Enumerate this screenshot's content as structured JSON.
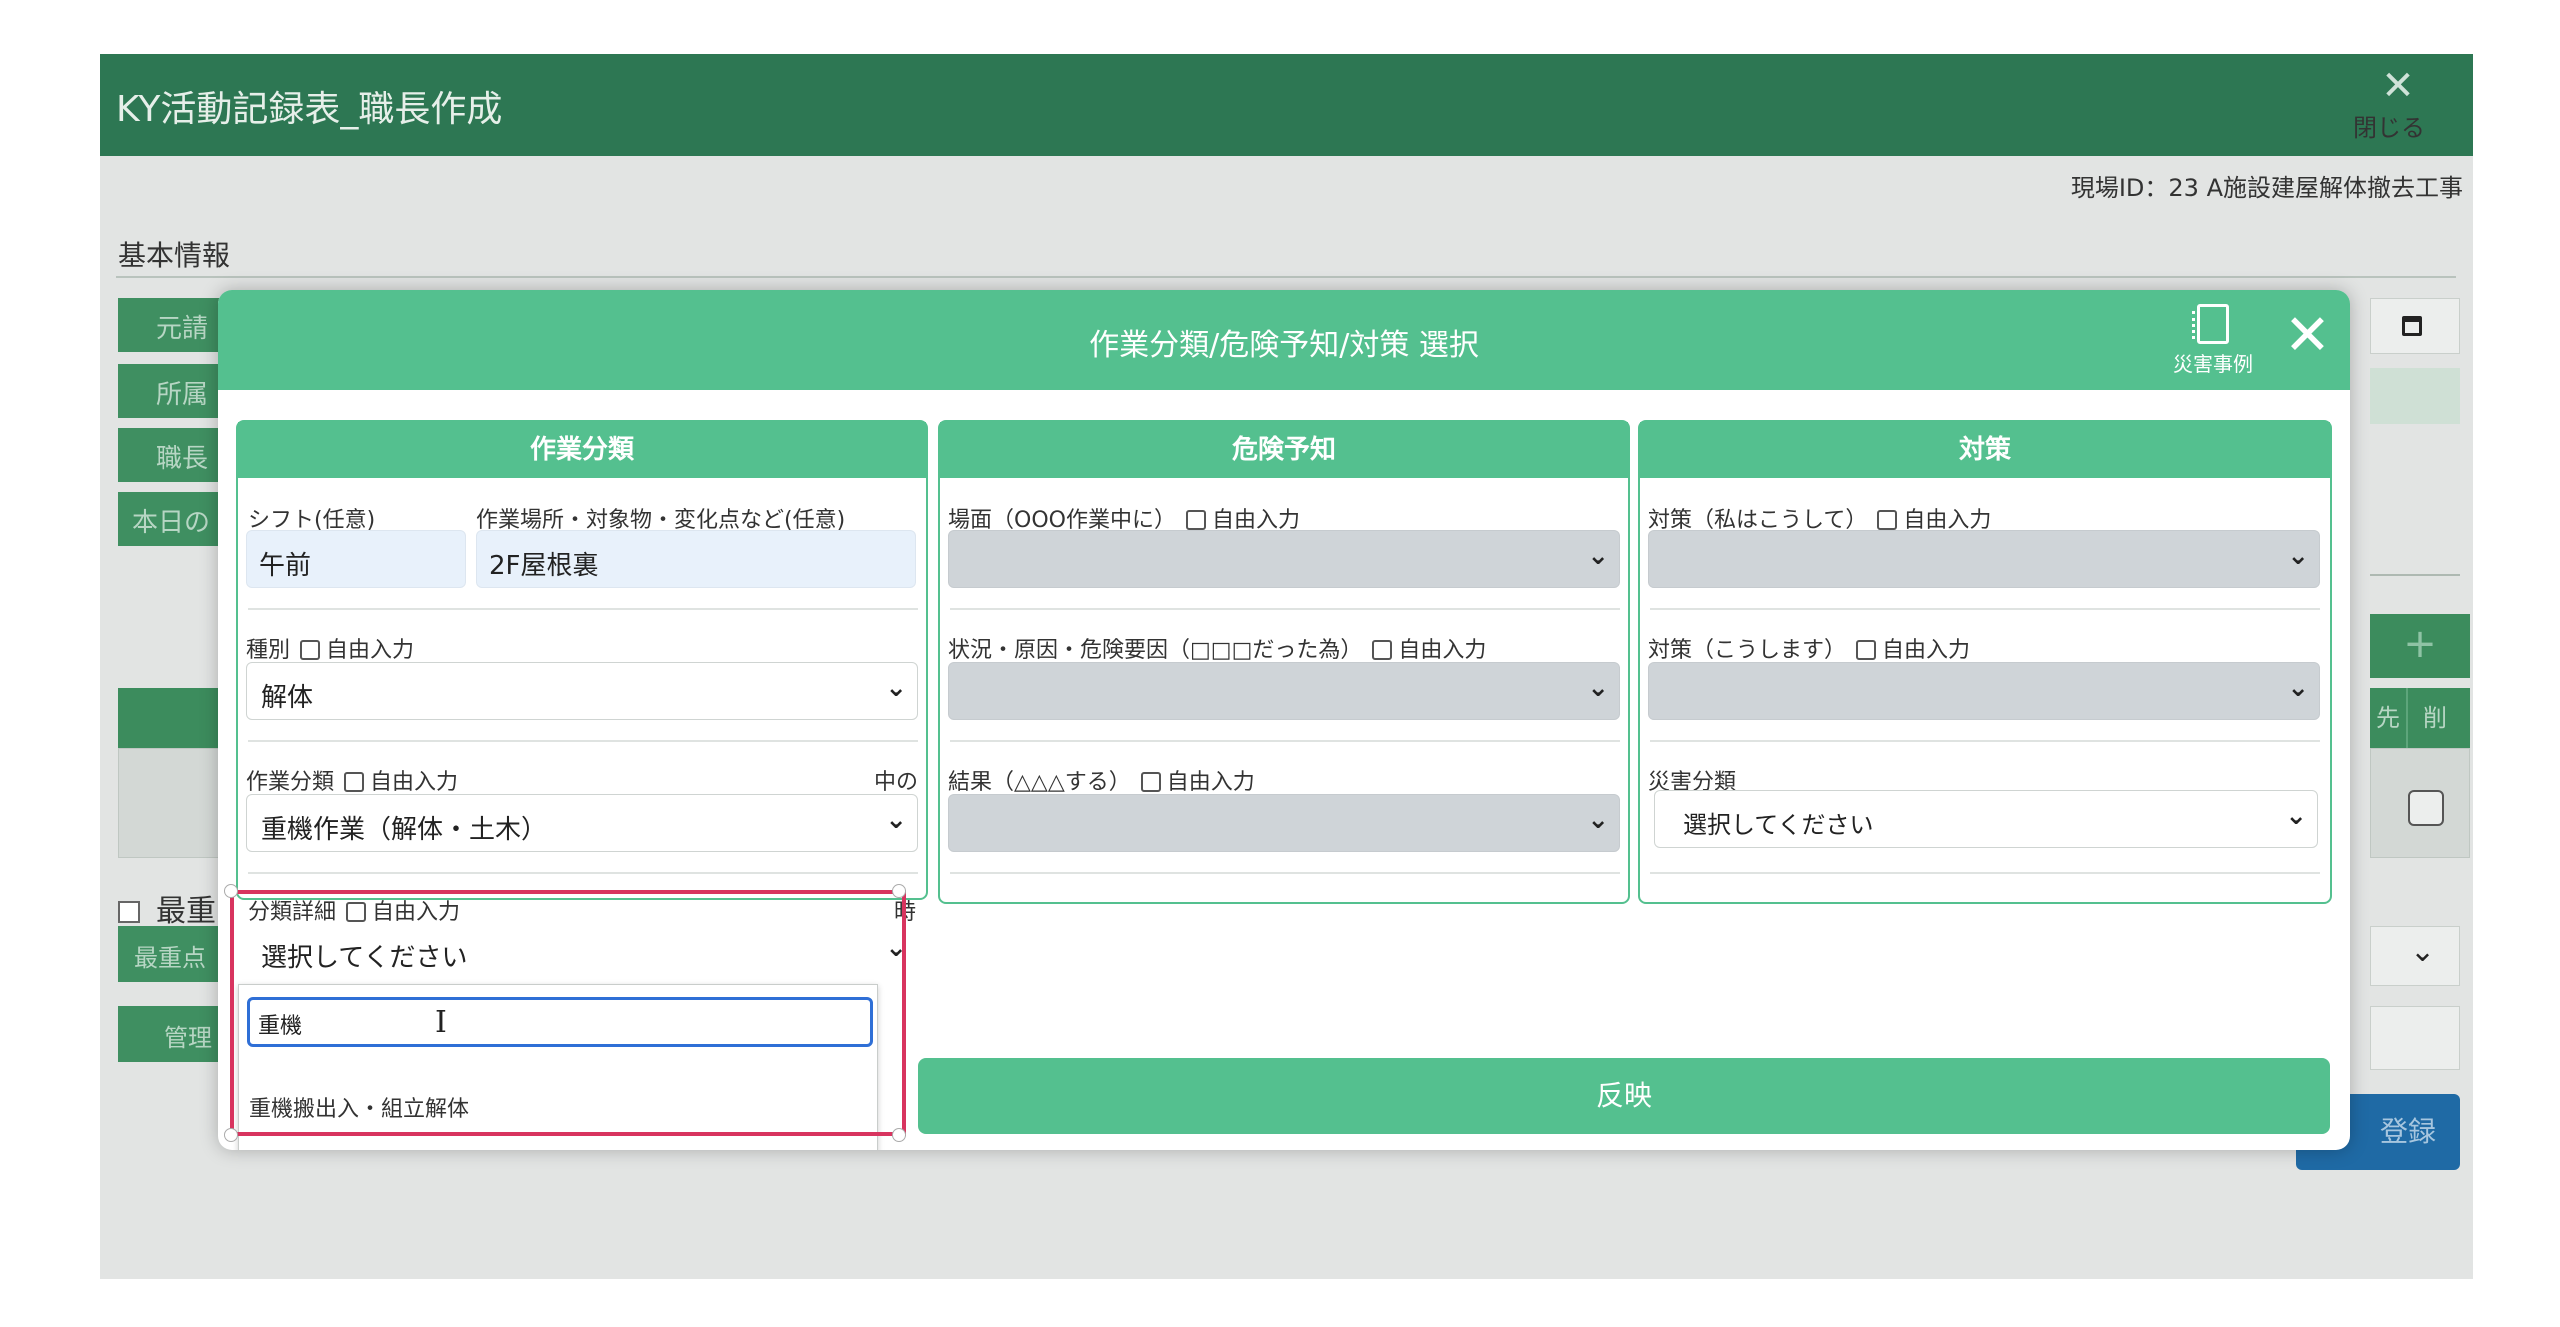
{
  "app": {
    "title": "KY活動記録表_職長作成",
    "close_label": "閉じる",
    "site_id": "現場ID：23 A施設建屋解体撤去工事",
    "section_title": "基本情報",
    "side_buttons": [
      "元請",
      "所属",
      "職長",
      "本日の"
    ],
    "most_important_checkbox": "最重",
    "side_button_5": "最重点",
    "side_button_6": "管理",
    "table_header_cells": [
      "先",
      "削"
    ],
    "plus_label": "+",
    "register_label": "登録"
  },
  "modal": {
    "title": "作業分類/危険予知/対策 選択",
    "disaster_label": "災害事例",
    "close_icon": "close-icon",
    "apply_label": "反映"
  },
  "panel1": {
    "header": "作業分類",
    "shift_label": "シフト(任意)",
    "shift_value": "午前",
    "place_label": "作業場所・対象物・変化点など(任意)",
    "place_value": "2F屋根裏",
    "type_label": "種別",
    "type_free": "自由入力",
    "type_value": "解体",
    "work_label": "作業分類",
    "work_free": "自由入力",
    "work_right_note": "中の",
    "work_value": "重機作業（解体・土木）",
    "detail_label": "分類詳細",
    "detail_free": "自由入力",
    "detail_right_note": "時",
    "detail_value": "選択してください"
  },
  "dropdown": {
    "search_value": "重機",
    "option_1": "重機搬出入・組立解体"
  },
  "panel2": {
    "header": "危険予知",
    "scene_label": "場面（OOO作業中に）",
    "scene_free": "自由入力",
    "cause_label": "状況・原因・危険要因（□□□だった為）",
    "cause_free": "自由入力",
    "result_label": "結果（△△△する）",
    "result_free": "自由入力"
  },
  "panel3": {
    "header": "対策",
    "measure1_label": "対策（私はこうして）",
    "measure1_free": "自由入力",
    "measure2_label": "対策（こうします）",
    "measure2_free": "自由入力",
    "disaster_class_label": "災害分類",
    "disaster_class_value": "選択してください"
  },
  "colors": {
    "app_header": "#2d7753",
    "modal_accent": "#54c08f",
    "highlight": "#d8345f",
    "focus": "#2f6fd6"
  }
}
